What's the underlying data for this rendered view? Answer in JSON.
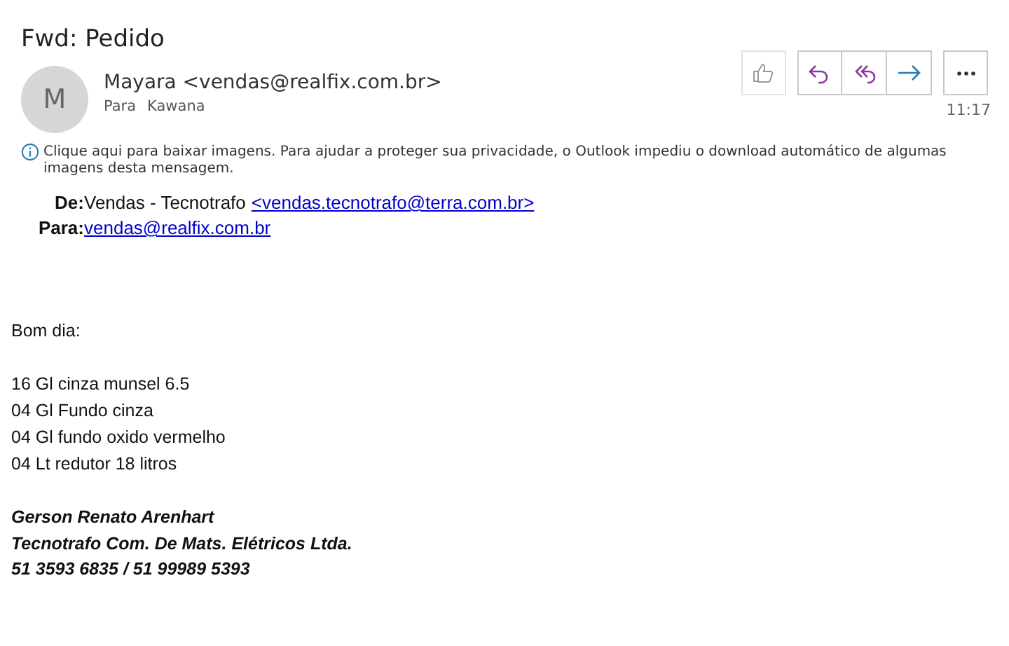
{
  "subject": "Fwd: Pedido",
  "sender": {
    "avatar": "M",
    "name": "Mayara <vendas@realfix.com.br>",
    "to_label": "Para",
    "to": "Kawana",
    "time": "11:17"
  },
  "actions": [
    {
      "kind": "like"
    },
    {
      "kind": "reply"
    },
    {
      "kind": "reply_all"
    },
    {
      "kind": "forward"
    },
    {
      "kind": "more"
    }
  ],
  "notice": "Clique aqui para baixar imagens. Para ajudar a proteger sua privacidade, o Outlook impediu o download automático de algumas imagens desta mensagem.",
  "forwarded": [
    {
      "label": "De:",
      "text": "Vendas - Tecnotrafo",
      "link": "<vendas.tecnotrafo@terra.com.br>"
    },
    {
      "label": "Para:",
      "link": "vendas@realfix.com.br"
    }
  ],
  "body": {
    "greeting": "Bom dia:",
    "items": [
      "16 Gl cinza munsel 6.5",
      "04 Gl Fundo cinza",
      "04 Gl fundo oxido vermelho",
      "04 Lt redutor 18 litros"
    ],
    "signature": [
      "Gerson Renato Arenhart",
      "Tecnotrafo Com. De Mats. Elétricos Ltda.",
      "51 3593 6835 / 51 99989 5393"
    ]
  }
}
